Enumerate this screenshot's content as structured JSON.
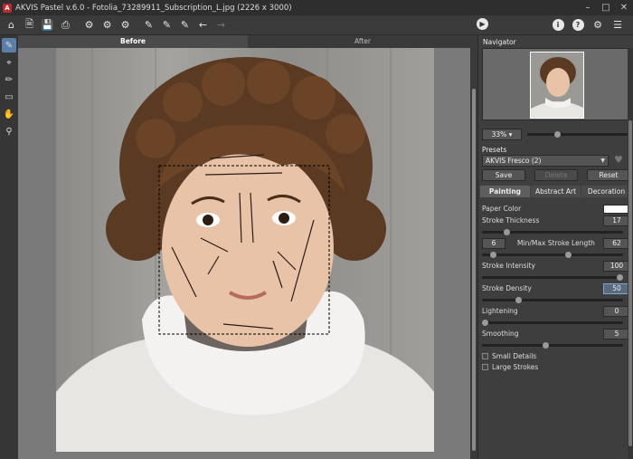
{
  "window": {
    "title": "AKVIS Pastel v.6.0 - Fotolia_73289911_Subscription_L.jpg (2226 x 3000)",
    "logo_letter": "A"
  },
  "view_tabs": {
    "before": "Before",
    "after": "After",
    "active": "before"
  },
  "navigator": {
    "title": "Navigator",
    "zoom": "33%",
    "zoom_fraction": 0.28
  },
  "presets": {
    "title": "Presets",
    "selected": "AKVIS Fresco (2)",
    "save": "Save",
    "delete": "Delete",
    "reset": "Reset"
  },
  "param_tabs": [
    "Painting",
    "Abstract Art",
    "Decoration"
  ],
  "params": {
    "paper_color": {
      "label": "Paper Color",
      "color": "#ffffff"
    },
    "stroke_thickness": {
      "label": "Stroke Thickness",
      "value": "17",
      "fraction": 0.16
    },
    "minmax": {
      "label": "Min/Max Stroke Length",
      "min": "6",
      "max": "62",
      "min_fraction": 0.06,
      "max_fraction": 0.62
    },
    "stroke_intensity": {
      "label": "Stroke Intensity",
      "value": "100",
      "fraction": 1.0
    },
    "stroke_density": {
      "label": "Stroke Density",
      "value": "50",
      "fraction": 0.25
    },
    "lightening": {
      "label": "Lightening",
      "value": "0",
      "fraction": 0.0
    },
    "smoothing": {
      "label": "Smoothing",
      "value": "5",
      "fraction": 0.45
    }
  },
  "checks": {
    "small_details": "Small Details",
    "large_strokes": "Large Strokes"
  },
  "colors": {
    "accent": "#7fa6d0",
    "panel": "#3e3e3e"
  }
}
